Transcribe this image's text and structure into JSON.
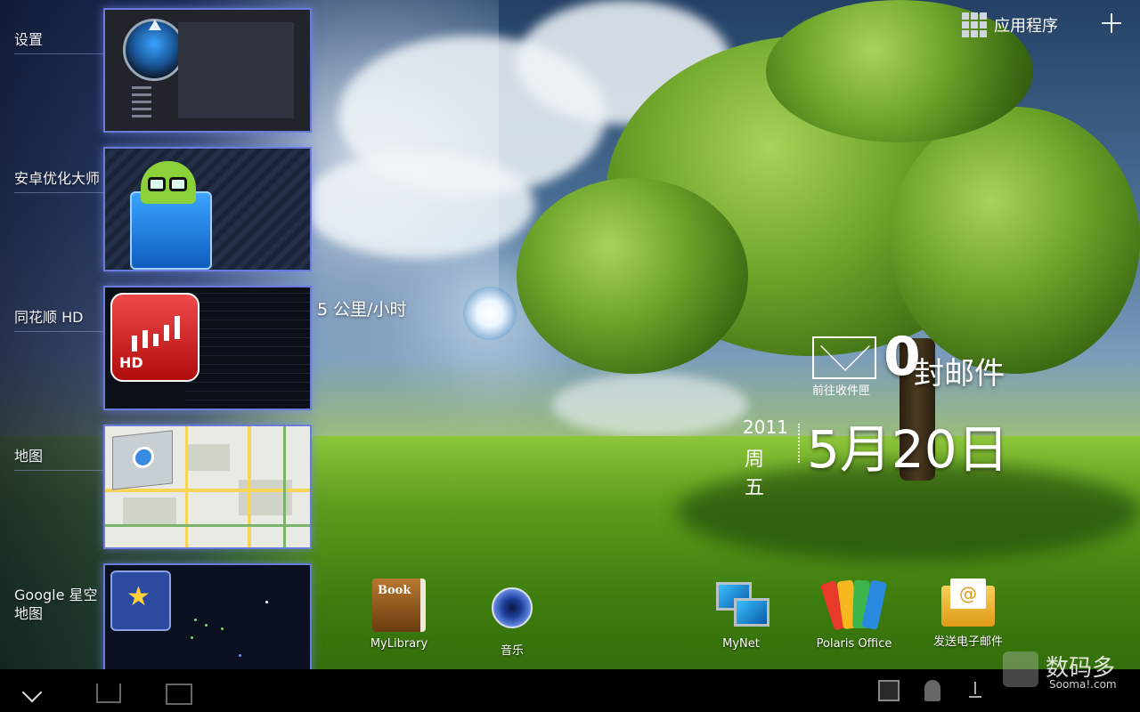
{
  "top_bar": {
    "apps_label": "应用程序"
  },
  "recent_apps": [
    {
      "label": "设置"
    },
    {
      "label": "安卓优化大师"
    },
    {
      "label": "同花顺 HD"
    },
    {
      "label": "地图"
    },
    {
      "label": "Google 星空\n地图"
    }
  ],
  "weather_text": "5 公里/小时",
  "mail_widget": {
    "count": "0",
    "unit": "封邮件",
    "link": "前往收件匣"
  },
  "date_widget": {
    "year": "2011",
    "weekday": "周五",
    "date": "5月20日"
  },
  "dock": [
    {
      "label": "MyLibrary",
      "icon": "book-icon"
    },
    {
      "label": "音乐",
      "icon": "music-icon"
    },
    {
      "label": "MyNet",
      "icon": "mynet-icon"
    },
    {
      "label": "Polaris Office",
      "icon": "polaris-office-icon"
    },
    {
      "label": "发送电子邮件",
      "icon": "email-icon"
    }
  ],
  "watermark": {
    "cn": "数码多",
    "en": "Sooma!.com"
  },
  "colors": {
    "panel_border": "#6a7bd8",
    "system_bar": "#000000"
  }
}
